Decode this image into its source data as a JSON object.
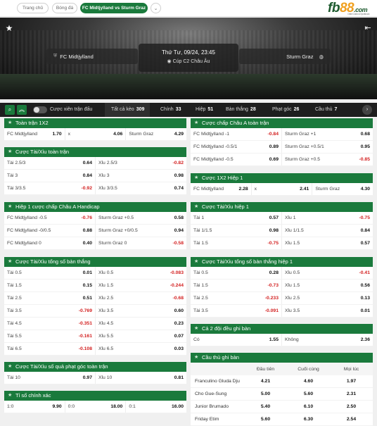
{
  "breadcrumb": [
    "Trang chủ",
    "Bóng đá",
    "FC Midtjylland vs Sturm Graz"
  ],
  "logo": {
    "text_a": "fb",
    "text_b": "88",
    "text_c": ".com",
    "tagline": "Online Casino & Sportsbook"
  },
  "match": {
    "home": "FC Midtjylland",
    "away": "Sturm Graz",
    "datetime": "Thứ Tư, 09/24, 23:45",
    "league": "Cúp C2 Châu Âu"
  },
  "filters": {
    "toggle_label": "Cược xiên trận đấu",
    "tabs": [
      {
        "label": "Tất cả kèo",
        "count": "309"
      },
      {
        "label": "Chính",
        "count": "33"
      },
      {
        "label": "Hiệp",
        "count": "51"
      },
      {
        "label": "Bàn thắng",
        "count": "28"
      },
      {
        "label": "Phạt góc",
        "count": "26"
      },
      {
        "label": "Cầu thủ",
        "count": "7"
      }
    ]
  },
  "colors": {
    "accent": "#1a7a3c",
    "negative": "#d32020",
    "bar": "#1e1e1e"
  },
  "left": {
    "p1": {
      "title": "Toàn trận 1X2",
      "rows": [
        [
          [
            "FC Midtjylland",
            "1.70"
          ],
          [
            "x",
            "4.06"
          ],
          [
            "Sturm Graz",
            "4.29"
          ]
        ]
      ]
    },
    "p2": {
      "title": "Cược Tài/Xỉu toàn trận",
      "rows": [
        [
          [
            "Tài 2.5/3",
            "0.64"
          ],
          [
            "Xỉu 2.5/3",
            "-0.82"
          ]
        ],
        [
          [
            "Tài 3",
            "0.84"
          ],
          [
            "Xỉu 3",
            "0.98"
          ]
        ],
        [
          [
            "Tài 3/3.5",
            "-0.92"
          ],
          [
            "Xỉu 3/3.5",
            "0.74"
          ]
        ]
      ]
    },
    "p3": {
      "title": "Hiệp 1 cược chấp Châu A Handicap",
      "rows": [
        [
          [
            "FC Midtjylland -0.5",
            "-0.76"
          ],
          [
            "Sturm Graz +0.5",
            "0.58"
          ]
        ],
        [
          [
            "FC Midtjylland -0/0.5",
            "0.88"
          ],
          [
            "Sturm Graz +0/0.5",
            "0.94"
          ]
        ],
        [
          [
            "FC Midtjylland 0",
            "0.40"
          ],
          [
            "Sturm Graz 0",
            "-0.58"
          ]
        ]
      ]
    },
    "p4": {
      "title": "Cược Tài/Xỉu tổng số bàn thắng",
      "rows": [
        [
          [
            "Tài 0.5",
            "0.01"
          ],
          [
            "Xỉu 0.5",
            "-0.083"
          ]
        ],
        [
          [
            "Tài 1.5",
            "0.15"
          ],
          [
            "Xỉu 1.5",
            "-0.244"
          ]
        ],
        [
          [
            "Tài 2.5",
            "0.51"
          ],
          [
            "Xỉu 2.5",
            "-0.68"
          ]
        ],
        [
          [
            "Tài 3.5",
            "-0.769"
          ],
          [
            "Xỉu 3.5",
            "0.60"
          ]
        ],
        [
          [
            "Tài 4.5",
            "-0.351"
          ],
          [
            "Xỉu 4.5",
            "0.23"
          ]
        ],
        [
          [
            "Tài 5.5",
            "-0.161"
          ],
          [
            "Xỉu 5.5",
            "0.07"
          ]
        ],
        [
          [
            "Tài 6.5",
            "-0.108"
          ],
          [
            "Xỉu 6.5",
            "0.03"
          ]
        ]
      ]
    },
    "p5": {
      "title": "Cược Tài/Xỉu số quả phạt góc toàn trận",
      "rows": [
        [
          [
            "Tài 10",
            "0.97"
          ],
          [
            "Xỉu 10",
            "0.81"
          ]
        ]
      ]
    },
    "p6": {
      "title": "Tỉ số chính xác",
      "rows": [
        [
          [
            "1:0",
            "9.90"
          ],
          [
            "0:0",
            "18.00"
          ],
          [
            "0:1",
            "16.00"
          ]
        ]
      ]
    }
  },
  "right": {
    "p1": {
      "title": "Cược chấp Châu A toàn trận",
      "rows": [
        [
          [
            "FC Midtjylland -1",
            "-0.84"
          ],
          [
            "Sturm Graz +1",
            "0.68"
          ]
        ],
        [
          [
            "FC Midtjylland -0.5/1",
            "0.89"
          ],
          [
            "Sturm Graz +0.5/1",
            "0.95"
          ]
        ],
        [
          [
            "FC Midtjylland -0.5",
            "0.69"
          ],
          [
            "Sturm Graz +0.5",
            "-0.85"
          ]
        ]
      ]
    },
    "p2": {
      "title": "Cược 1X2 Hiệp 1",
      "rows": [
        [
          [
            "FC Midtjylland",
            "2.28"
          ],
          [
            "x",
            "2.41"
          ],
          [
            "Sturm Graz",
            "4.30"
          ]
        ]
      ]
    },
    "p3": {
      "title": "Cược Tài/Xỉu hiệp 1",
      "rows": [
        [
          [
            "Tài 1",
            "0.57"
          ],
          [
            "Xỉu 1",
            "-0.75"
          ]
        ],
        [
          [
            "Tài 1/1.5",
            "0.98"
          ],
          [
            "Xỉu 1/1.5",
            "0.84"
          ]
        ],
        [
          [
            "Tài 1.5",
            "-0.75"
          ],
          [
            "Xỉu 1.5",
            "0.57"
          ]
        ]
      ]
    },
    "p4": {
      "title": "Cược Tài/Xỉu tổng số bàn thắng hiệp 1",
      "rows": [
        [
          [
            "Tài 0.5",
            "0.28"
          ],
          [
            "Xỉu 0.5",
            "-0.41"
          ]
        ],
        [
          [
            "Tài 1.5",
            "-0.73"
          ],
          [
            "Xỉu 1.5",
            "0.56"
          ]
        ],
        [
          [
            "Tài 2.5",
            "-0.233"
          ],
          [
            "Xỉu 2.5",
            "0.13"
          ]
        ],
        [
          [
            "Tài 3.5",
            "-0.091"
          ],
          [
            "Xỉu 3.5",
            "0.01"
          ]
        ]
      ]
    },
    "p5": {
      "title": "Cả 2 đội đều ghi bàn",
      "rows": [
        [
          [
            "Có",
            "1.55"
          ],
          [
            "Không",
            "2.36"
          ]
        ]
      ]
    },
    "p6": {
      "title": "Cầu thủ ghi bàn",
      "columns": [
        "Đầu tiên",
        "Cuối cùng",
        "Mọi lúc"
      ],
      "rows": [
        {
          "name": "Franculino Gluda Dju",
          "odds": [
            "4.21",
            "4.60",
            "1.97"
          ]
        },
        {
          "name": "Cho Gue-Sung",
          "odds": [
            "5.00",
            "5.60",
            "2.31"
          ]
        },
        {
          "name": "Junior Brumado",
          "odds": [
            "5.40",
            "6.10",
            "2.50"
          ]
        },
        {
          "name": "Friday Etim",
          "odds": [
            "5.60",
            "6.30",
            "2.54"
          ]
        }
      ]
    }
  }
}
